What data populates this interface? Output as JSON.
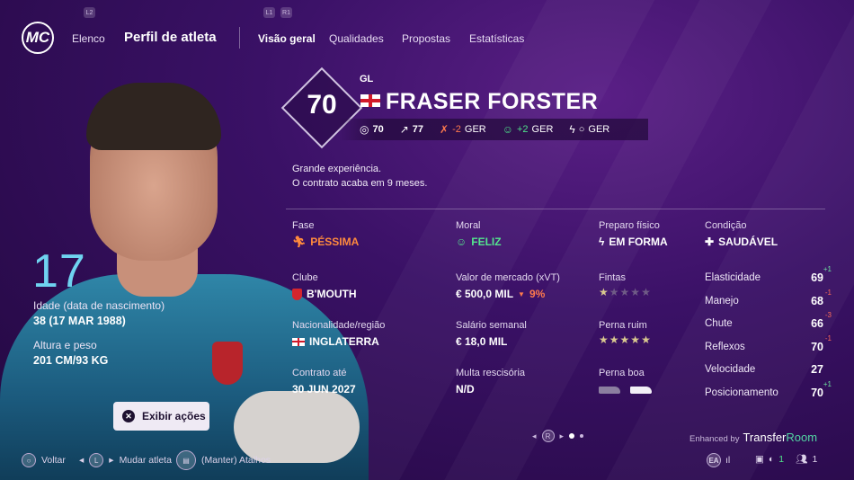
{
  "nav": {
    "logo": "MC",
    "elenco": "Elenco",
    "title": "Perfil de atleta",
    "tabs": [
      "Visão geral",
      "Qualidades",
      "Propostas",
      "Estatísticas"
    ],
    "hint_l2": "L2",
    "hint_l1": "L1",
    "hint_r1": "R1"
  },
  "player": {
    "rating": "70",
    "position": "GL",
    "name": "FRASER FORSTER",
    "shirt_number": "17",
    "age_label": "Idade (data de nascimento)",
    "age_value": "38 (17 MAR 1988)",
    "height_label": "Altura e peso",
    "height_value": "201 CM/93 KG",
    "strip": {
      "ovr": "70",
      "pot": "77",
      "form_delta": "-2",
      "form_unit": "GER",
      "morale_delta": "+2",
      "morale_unit": "GER",
      "sharp_value": "○",
      "sharp_unit": "GER"
    },
    "description_1": "Grande experiência.",
    "description_2": "O contrato acaba em 9 meses."
  },
  "info": {
    "fase_label": "Fase",
    "fase_value": "PÉSSIMA",
    "moral_label": "Moral",
    "moral_value": "FELIZ",
    "preparo_label": "Preparo físico",
    "preparo_value": "EM FORMA",
    "condicao_label": "Condição",
    "condicao_value": "SAUDÁVEL",
    "clube_label": "Clube",
    "clube_value": "B'MOUTH",
    "valor_label": "Valor de mercado (xVT)",
    "valor_value": "€ 500,0 MIL",
    "valor_change": "9%",
    "fintas_label": "Fintas",
    "fintas_stars": 1,
    "nacionalidade_label": "Nacionalidade/região",
    "nacionalidade_value": "INGLATERRA",
    "salario_label": "Salário semanal",
    "salario_value": "€ 18,0 MIL",
    "perna_ruim_label": "Perna ruim",
    "perna_ruim_stars": 5,
    "contrato_label": "Contrato até",
    "contrato_value": "30 JUN 2027",
    "multa_label": "Multa rescisória",
    "multa_value": "N/D",
    "perna_boa_label": "Perna boa"
  },
  "attributes": [
    {
      "name": "Elasticidade",
      "value": "69",
      "change": "+1",
      "trend": "up"
    },
    {
      "name": "Manejo",
      "value": "68",
      "change": "-1",
      "trend": "down"
    },
    {
      "name": "Chute",
      "value": "66",
      "change": "-3",
      "trend": "down"
    },
    {
      "name": "Reflexos",
      "value": "70",
      "change": "-1",
      "trend": "down"
    },
    {
      "name": "Velocidade",
      "value": "27",
      "change": "",
      "trend": "none"
    },
    {
      "name": "Posicionamento",
      "value": "70",
      "change": "+1",
      "trend": "up"
    }
  ],
  "actions": {
    "exibir": "Exibir ações",
    "voltar": "Voltar",
    "mudar": "Mudar atleta",
    "atalhos": "(Manter) Atalhos",
    "l_hint": "L",
    "r_hint": "R"
  },
  "footer": {
    "enhanced_by": "Enhanced by",
    "brand_a": "Transfer",
    "brand_b": "Room",
    "count_green": "1",
    "count_people": "1"
  },
  "colors": {
    "accent_orange": "#ff8a3d",
    "accent_green": "#54e48e",
    "shirt_number": "#6fd3f0"
  }
}
